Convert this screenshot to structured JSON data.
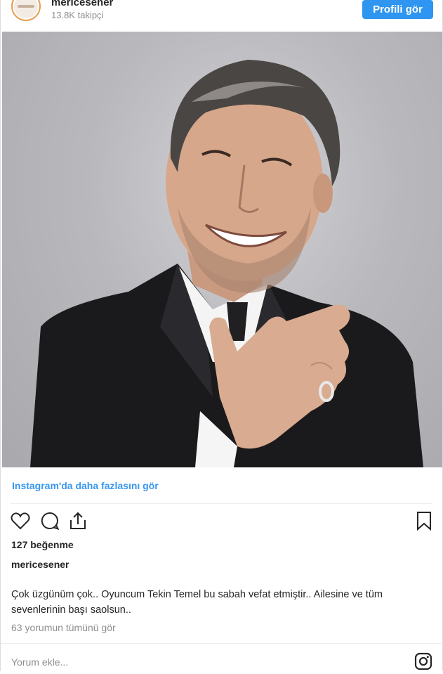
{
  "header": {
    "username": "mericesener",
    "followers": "13.8K takipçi",
    "profile_button": "Profili gör"
  },
  "post": {
    "more_link": "Instagram'da daha fazlasını gör",
    "likes": "127 beğenme",
    "caption_user": "mericesener",
    "caption_text": "Çok üzgünüm çok.. Oyuncum Tekin Temel bu sabah vefat etmiştir.. Ailesine ve tüm sevenlerinin başı saolsun..",
    "comments_link": "63 yorumun tümünü gör",
    "add_comment_placeholder": "Yorum ekle..."
  },
  "icons": {
    "like": "heart-icon",
    "comment": "comment-bubble-icon",
    "share": "share-icon",
    "save": "bookmark-icon",
    "instagram": "instagram-icon"
  },
  "colors": {
    "accent": "#2e95f0",
    "link": "#3897f0",
    "muted": "#8e8e8e"
  }
}
